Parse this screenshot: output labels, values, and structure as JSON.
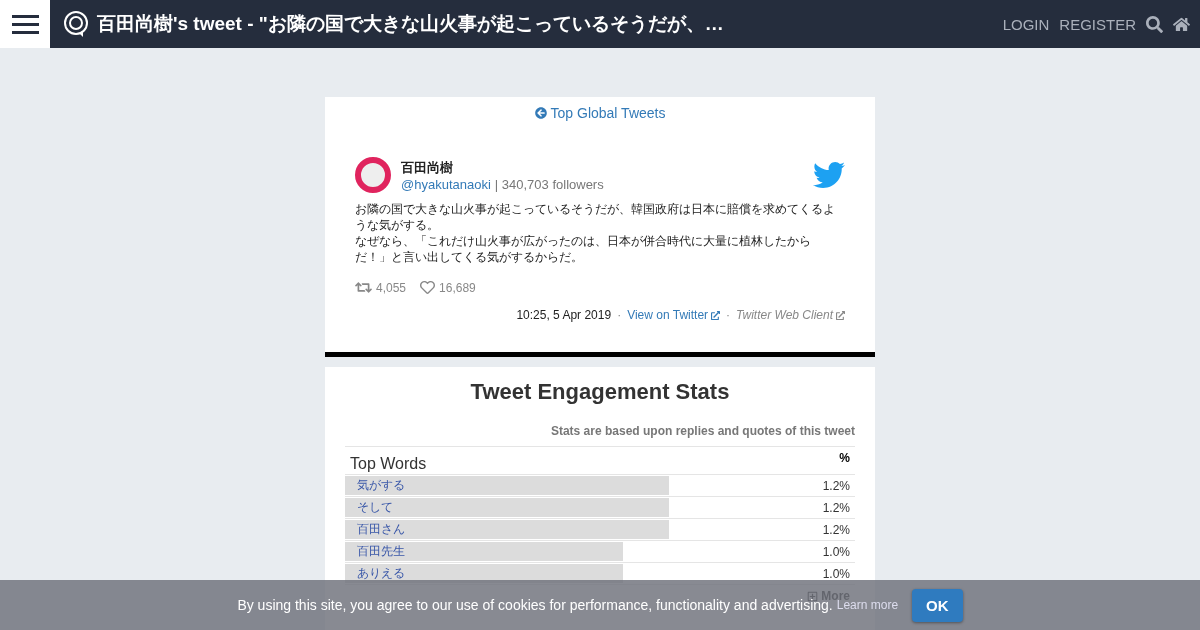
{
  "header": {
    "title": "百田尚樹's tweet - \"お隣の国で大きな山火事が起こっているそうだが、…",
    "nav": [
      "LOGIN",
      "REGISTER"
    ]
  },
  "back_link": "Top Global Tweets",
  "tweet": {
    "name": "百田尚樹",
    "handle": "@hyakutanaoki",
    "followers": "| 340,703 followers",
    "lines": [
      "お隣の国で大きな山火事が起こっているそうだが、韓国政府は日本に賠償を求めてくるような気がする。",
      "なぜなら、「これだけ山火事が広がったのは、日本が併合時代に大量に植林したからだ！」と言い出してくる気がするからだ。"
    ],
    "retweets": "4,055",
    "likes": "16,689",
    "time": "10:25, 5 Apr 2019",
    "separators": [
      "·",
      "·"
    ],
    "view_link": "View on Twitter",
    "client": "Twitter Web Client"
  },
  "stats": {
    "title": "Tweet Engagement Stats",
    "note": "Stats are based upon replies and quotes of this tweet",
    "table_title": "Top Words",
    "column_2": "%",
    "rows": [
      {
        "word": "気がする",
        "percent": "1.2%",
        "level": 0.635
      },
      {
        "word": "そして",
        "percent": "1.2%",
        "level": 0.635
      },
      {
        "word": "百田さん",
        "percent": "1.2%",
        "level": 0.635
      },
      {
        "word": "百田先生",
        "percent": "1.0%",
        "level": 0.545
      },
      {
        "word": "ありえる",
        "percent": "1.0%",
        "level": 0.545
      }
    ],
    "more": "More"
  },
  "cookie": {
    "text": "By using this site, you agree to our use of cookies for performance, functionality and advertising.",
    "link": "Learn more",
    "button": "OK"
  }
}
